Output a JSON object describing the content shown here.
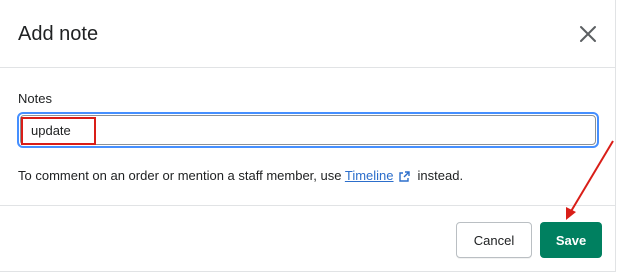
{
  "dialog": {
    "title": "Add note",
    "close_icon": "close-icon"
  },
  "notes": {
    "label": "Notes",
    "value": "update"
  },
  "helper": {
    "prefix": "To comment on an order or mention a staff member, use",
    "link_text": "Timeline",
    "link_icon": "external-link-icon",
    "suffix": "instead."
  },
  "footer": {
    "cancel_label": "Cancel",
    "save_label": "Save"
  },
  "colors": {
    "primary": "#008060",
    "focus": "#458fff",
    "link": "#2c6ecb",
    "annotation": "#d91e18"
  }
}
